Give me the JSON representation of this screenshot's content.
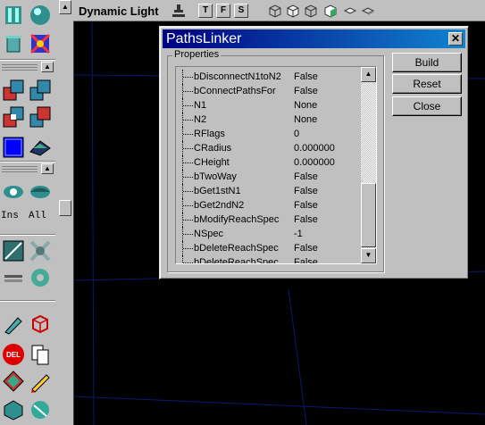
{
  "viewport": {
    "title": "Dynamic Light",
    "buttons": [
      "T",
      "F",
      "S"
    ]
  },
  "toolbox": {
    "ins_label": "Ins",
    "all_label": "All",
    "del_label": "DEL",
    "collapse_glyph": "▲"
  },
  "dialog": {
    "title": "PathsLinker",
    "close_glyph": "✕",
    "group_label": "Properties",
    "properties": [
      {
        "name": "bDisconnectN1toN2",
        "value": "False"
      },
      {
        "name": "bConnectPathsFor",
        "value": "False"
      },
      {
        "name": "N1",
        "value": "None"
      },
      {
        "name": "N2",
        "value": "None"
      },
      {
        "name": "RFlags",
        "value": "0"
      },
      {
        "name": "CRadius",
        "value": "0.000000"
      },
      {
        "name": "CHeight",
        "value": "0.000000"
      },
      {
        "name": "bTwoWay",
        "value": "False"
      },
      {
        "name": "bGet1stN1",
        "value": "False"
      },
      {
        "name": "bGet2ndN2",
        "value": "False"
      },
      {
        "name": "bModifyReachSpec",
        "value": "False"
      },
      {
        "name": "NSpec",
        "value": "-1"
      },
      {
        "name": "bDeleteReachSpec",
        "value": "False"
      },
      {
        "name": "bDeleteReachSpec",
        "value": "False"
      }
    ],
    "scroll_up_glyph": "▲",
    "scroll_down_glyph": "▼",
    "build_label": "Build",
    "reset_label": "Reset",
    "close_label": "Close"
  },
  "colors": {
    "title_bar": "#000080",
    "viewport_bg": "#000000",
    "grid_line": "#0a1a6a"
  }
}
